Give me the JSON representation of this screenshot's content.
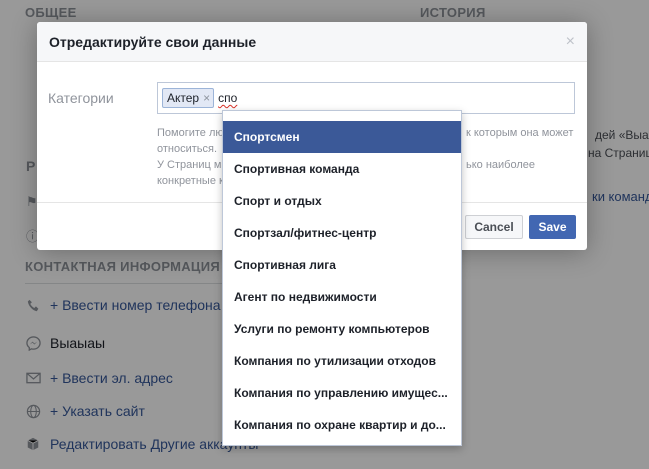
{
  "background": {
    "headers": {
      "general": "ОБЩЕЕ",
      "history": "ИСТОРИЯ",
      "contact": "КОНТАКТНАЯ ИНФОРМАЦИЯ"
    },
    "fragments": {
      "r_letter": "Р",
      "right_line1": "к которым она может",
      "right_line2": "относиться.",
      "right_line3": "ько наиболее",
      "far_right1": "дей «Выаы",
      "far_right2": "на Страниц",
      "far_right3": "ки команд"
    },
    "rows": [
      {
        "icon": "phone-icon",
        "text": "+ Ввести номер телефона"
      },
      {
        "icon": "messenger-icon",
        "text": "Выаыаы"
      },
      {
        "icon": "mail-icon",
        "text": "+ Ввести эл. адрес"
      },
      {
        "icon": "globe-icon",
        "text": "+ Указать сайт"
      },
      {
        "icon": "cube-icon",
        "text": "Редактировать Другие аккаунты"
      }
    ]
  },
  "modal": {
    "title": "Отредактируйте свои данные",
    "close_glyph": "×",
    "category_label": "Категории",
    "token": "Актер",
    "token_remove_glyph": "×",
    "input_value": "спо",
    "help_lines": [
      "Помогите лю",
      "относиться.",
      "У Страниц м",
      "конкретные к"
    ],
    "cancel_label": "Cancel",
    "save_label": "Save"
  },
  "dropdown": {
    "items": [
      "Спортсмен",
      "Спортивная команда",
      "Спорт и отдых",
      "Спортзал/фитнес-центр",
      "Спортивная лига",
      "Агент по недвижимости",
      "Услуги по ремонту компьютеров",
      "Компания по утилизации отходов",
      "Компания по управлению имущес...",
      "Компания по охране квартир и до..."
    ],
    "highlighted_index": 0
  },
  "colors": {
    "accent": "#4267b2",
    "highlight": "#3b5998",
    "link": "#365899"
  }
}
